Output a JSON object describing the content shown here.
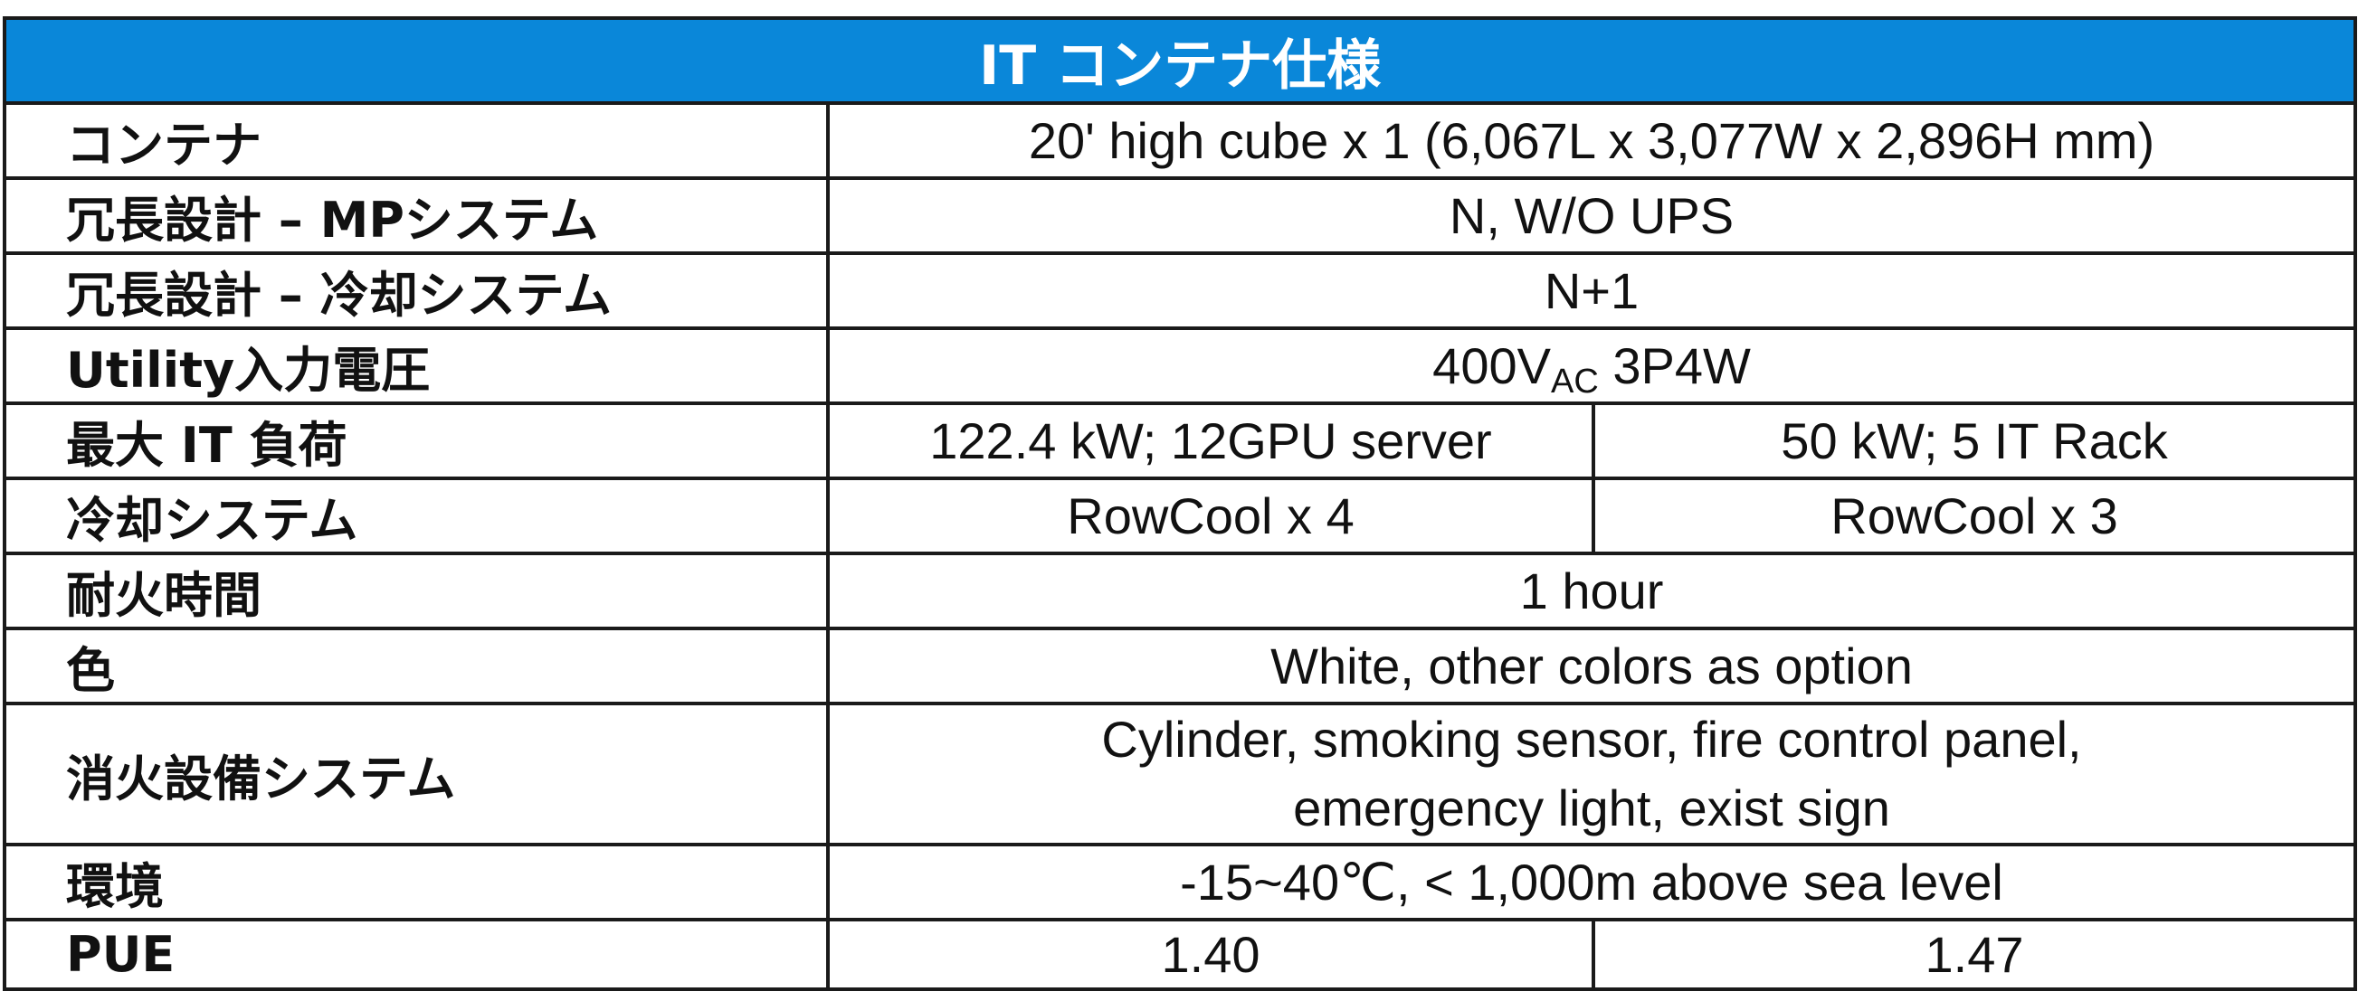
{
  "title": "IT コンテナ仕様",
  "header_color": "#0A87D9",
  "rows": [
    {
      "label": "コンテナ",
      "value": "20' high cube x 1 (6,067L x 3,077W x 2,896H mm)"
    },
    {
      "label": "冗長設計 – MPシステム",
      "value": "N, W/O UPS"
    },
    {
      "label": "冗長設計 – 冷却システム",
      "value": "N+1"
    },
    {
      "label": "Utility入力電圧",
      "value_main": "400V",
      "value_sub": "AC",
      "value_tail": " 3P4W"
    },
    {
      "label": "最大 IT 負荷",
      "value_a": "122.4 kW; 12GPU server",
      "value_b": "50 kW; 5 IT Rack"
    },
    {
      "label": "冷却システム",
      "value_a": "RowCool x 4",
      "value_b": "RowCool x 3"
    },
    {
      "label": "耐火時間",
      "value": "1 hour"
    },
    {
      "label": "色",
      "value": "White, other colors as option"
    },
    {
      "label": "消火設備システム",
      "value_line1": "Cylinder, smoking sensor, fire control panel,",
      "value_line2": "emergency light, exist sign"
    },
    {
      "label": "環境",
      "value": "-15~40℃, < 1,000m above sea level"
    },
    {
      "label": "PUE",
      "value_a": "1.40",
      "value_b": "1.47"
    }
  ]
}
